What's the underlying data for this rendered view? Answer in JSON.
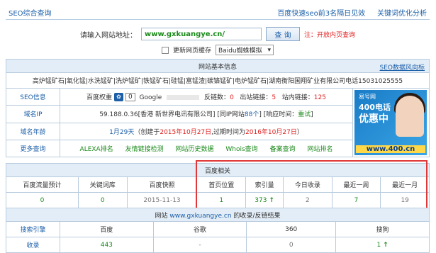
{
  "topbar": {
    "title": "SEO综合查询",
    "link1": "百度快速seo前3名隔日见效",
    "link2": "关键词优化分析"
  },
  "search": {
    "label": "请输入网站地址：",
    "value": "www.gxkuangye.cn/",
    "button": "查 询",
    "note": "注：开放内页查询",
    "refresh_label": "更新网页缓存",
    "ua_value": "Baidu蜘蛛模拟"
  },
  "basic": {
    "header": "网站基本信息",
    "header_link": "SEO数据风向标",
    "keywords": "高炉锰矿石|氧化锰|水洗锰矿|洗炉锰矿|铁锰矿石|硅锰|富锰渣|碳铬锰矿|电炉锰矿石|湖南衡阳国翔矿业有限公司电话15031025555",
    "seo_label": "SEO信息",
    "baidu_weight_label": "百度权重",
    "baidu_weight_value": "0",
    "google_label": "Google",
    "backlinks_label": "反链数：",
    "backlinks_value": "0",
    "outlinks_label": "出站链接：",
    "outlinks_value": "5",
    "inlinks_label": "站内链接：",
    "inlinks_value": "125",
    "ip_label": "域名IP",
    "ip_prefix": "59.188.0.36[香港 新世界电讯有限公司] [同IP网站",
    "ip_count": "88个",
    "ip_mid": "] [响应时间：",
    "ip_resp": "重试",
    "ip_end": "]",
    "age_label": "域名年龄",
    "age_value": "1月29天",
    "age_mid1": "（创建于",
    "age_created": "2015年10月27日",
    "age_mid2": ",过期时间为",
    "age_expire": "2016年10月27日",
    "age_end": "）",
    "more_label": "更多查询",
    "more_links": [
      "ALEXA排名",
      "友情链接检测",
      "网站历史数据",
      "Whois查询",
      "备案查询",
      "网站排名"
    ]
  },
  "ad": {
    "brand": "易号网",
    "line1": "400电话",
    "line2": "优惠中",
    "url": "www.400.cn"
  },
  "baidu": {
    "header": "百度相关",
    "columns": [
      "百度流量预计",
      "关键词库",
      "百度快照",
      "首页位置",
      "索引量",
      "今日收录",
      "最近一周",
      "最近一月"
    ],
    "values": [
      "0",
      "0",
      "2015-11-13",
      "1",
      "373",
      "2",
      "7",
      "19"
    ]
  },
  "index_table": {
    "header_prefix": "网站",
    "header_site": "www.gxkuangye.cn",
    "header_suffix": "的收录/反链结果",
    "columns": [
      "搜索引擎",
      "百度",
      "谷歌",
      "360",
      "搜狗"
    ],
    "row_label": "收录",
    "row_values": [
      "443",
      "-",
      "0",
      "1"
    ]
  }
}
